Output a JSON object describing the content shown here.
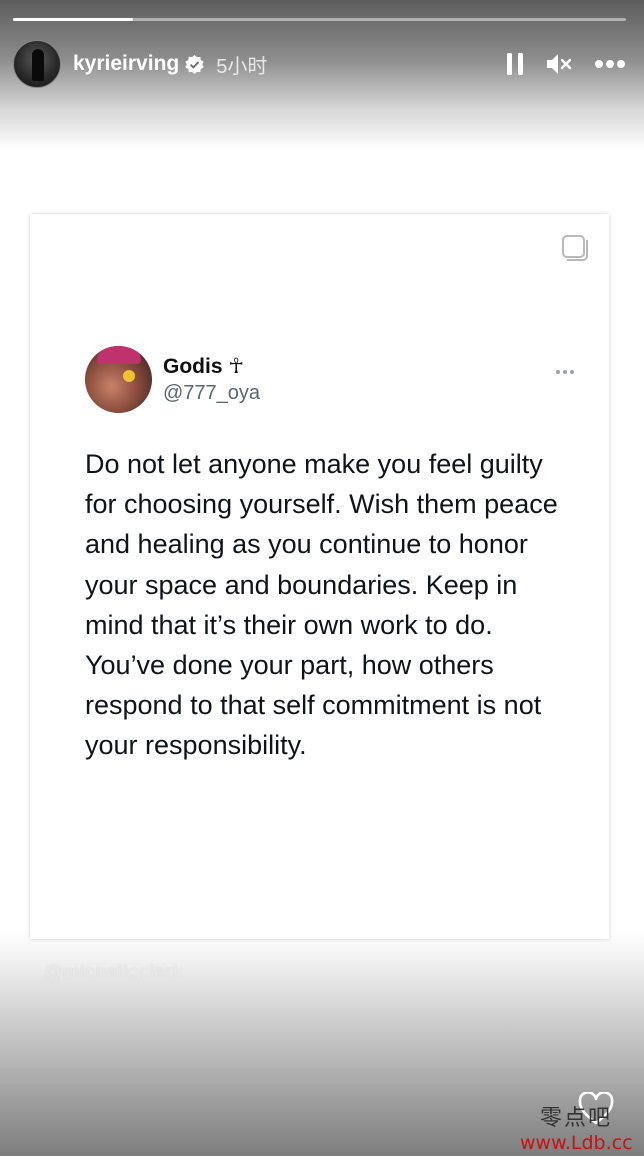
{
  "story": {
    "progress": 0.195,
    "username": "kyrieirving",
    "verified": true,
    "timestamp": "5小时",
    "controls": {
      "pause": "pause-icon",
      "mute": "volume-muted-icon",
      "more": "more-horizontal-icon"
    }
  },
  "tweet": {
    "display_name": "Godis ☥",
    "handle": "@777_oya",
    "text": "Do not let anyone make you feel guilty for choosing yourself. Wish them peace and healing as you continue to honor your space and boundaries. Keep in mind that it’s their own work to do. You’ve done your part, how others respond to that self commitment is not your responsibility."
  },
  "overlay": {
    "mention": "@michellcclark"
  },
  "site_watermark": {
    "chinese": "零点吧",
    "url": "www.Ldb.cc"
  },
  "colors": {
    "verified": "#ffffff",
    "url_red": "#cc1010",
    "text": "#0f1419",
    "handle": "#5b6670"
  }
}
